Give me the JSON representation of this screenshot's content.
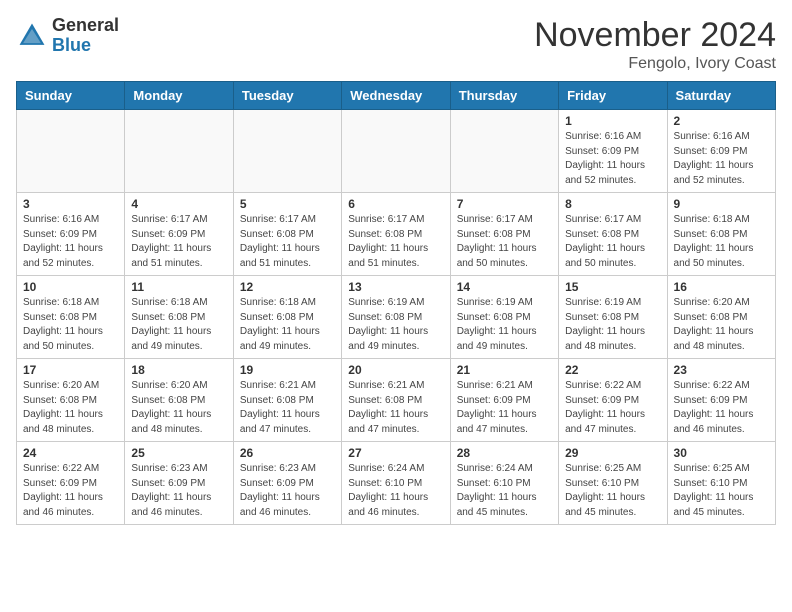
{
  "header": {
    "logo_general": "General",
    "logo_blue": "Blue",
    "month_title": "November 2024",
    "location": "Fengolo, Ivory Coast"
  },
  "days_of_week": [
    "Sunday",
    "Monday",
    "Tuesday",
    "Wednesday",
    "Thursday",
    "Friday",
    "Saturday"
  ],
  "weeks": [
    [
      {
        "day": "",
        "info": ""
      },
      {
        "day": "",
        "info": ""
      },
      {
        "day": "",
        "info": ""
      },
      {
        "day": "",
        "info": ""
      },
      {
        "day": "",
        "info": ""
      },
      {
        "day": "1",
        "info": "Sunrise: 6:16 AM\nSunset: 6:09 PM\nDaylight: 11 hours and 52 minutes."
      },
      {
        "day": "2",
        "info": "Sunrise: 6:16 AM\nSunset: 6:09 PM\nDaylight: 11 hours and 52 minutes."
      }
    ],
    [
      {
        "day": "3",
        "info": "Sunrise: 6:16 AM\nSunset: 6:09 PM\nDaylight: 11 hours and 52 minutes."
      },
      {
        "day": "4",
        "info": "Sunrise: 6:17 AM\nSunset: 6:09 PM\nDaylight: 11 hours and 51 minutes."
      },
      {
        "day": "5",
        "info": "Sunrise: 6:17 AM\nSunset: 6:08 PM\nDaylight: 11 hours and 51 minutes."
      },
      {
        "day": "6",
        "info": "Sunrise: 6:17 AM\nSunset: 6:08 PM\nDaylight: 11 hours and 51 minutes."
      },
      {
        "day": "7",
        "info": "Sunrise: 6:17 AM\nSunset: 6:08 PM\nDaylight: 11 hours and 50 minutes."
      },
      {
        "day": "8",
        "info": "Sunrise: 6:17 AM\nSunset: 6:08 PM\nDaylight: 11 hours and 50 minutes."
      },
      {
        "day": "9",
        "info": "Sunrise: 6:18 AM\nSunset: 6:08 PM\nDaylight: 11 hours and 50 minutes."
      }
    ],
    [
      {
        "day": "10",
        "info": "Sunrise: 6:18 AM\nSunset: 6:08 PM\nDaylight: 11 hours and 50 minutes."
      },
      {
        "day": "11",
        "info": "Sunrise: 6:18 AM\nSunset: 6:08 PM\nDaylight: 11 hours and 49 minutes."
      },
      {
        "day": "12",
        "info": "Sunrise: 6:18 AM\nSunset: 6:08 PM\nDaylight: 11 hours and 49 minutes."
      },
      {
        "day": "13",
        "info": "Sunrise: 6:19 AM\nSunset: 6:08 PM\nDaylight: 11 hours and 49 minutes."
      },
      {
        "day": "14",
        "info": "Sunrise: 6:19 AM\nSunset: 6:08 PM\nDaylight: 11 hours and 49 minutes."
      },
      {
        "day": "15",
        "info": "Sunrise: 6:19 AM\nSunset: 6:08 PM\nDaylight: 11 hours and 48 minutes."
      },
      {
        "day": "16",
        "info": "Sunrise: 6:20 AM\nSunset: 6:08 PM\nDaylight: 11 hours and 48 minutes."
      }
    ],
    [
      {
        "day": "17",
        "info": "Sunrise: 6:20 AM\nSunset: 6:08 PM\nDaylight: 11 hours and 48 minutes."
      },
      {
        "day": "18",
        "info": "Sunrise: 6:20 AM\nSunset: 6:08 PM\nDaylight: 11 hours and 48 minutes."
      },
      {
        "day": "19",
        "info": "Sunrise: 6:21 AM\nSunset: 6:08 PM\nDaylight: 11 hours and 47 minutes."
      },
      {
        "day": "20",
        "info": "Sunrise: 6:21 AM\nSunset: 6:08 PM\nDaylight: 11 hours and 47 minutes."
      },
      {
        "day": "21",
        "info": "Sunrise: 6:21 AM\nSunset: 6:09 PM\nDaylight: 11 hours and 47 minutes."
      },
      {
        "day": "22",
        "info": "Sunrise: 6:22 AM\nSunset: 6:09 PM\nDaylight: 11 hours and 47 minutes."
      },
      {
        "day": "23",
        "info": "Sunrise: 6:22 AM\nSunset: 6:09 PM\nDaylight: 11 hours and 46 minutes."
      }
    ],
    [
      {
        "day": "24",
        "info": "Sunrise: 6:22 AM\nSunset: 6:09 PM\nDaylight: 11 hours and 46 minutes."
      },
      {
        "day": "25",
        "info": "Sunrise: 6:23 AM\nSunset: 6:09 PM\nDaylight: 11 hours and 46 minutes."
      },
      {
        "day": "26",
        "info": "Sunrise: 6:23 AM\nSunset: 6:09 PM\nDaylight: 11 hours and 46 minutes."
      },
      {
        "day": "27",
        "info": "Sunrise: 6:24 AM\nSunset: 6:10 PM\nDaylight: 11 hours and 46 minutes."
      },
      {
        "day": "28",
        "info": "Sunrise: 6:24 AM\nSunset: 6:10 PM\nDaylight: 11 hours and 45 minutes."
      },
      {
        "day": "29",
        "info": "Sunrise: 6:25 AM\nSunset: 6:10 PM\nDaylight: 11 hours and 45 minutes."
      },
      {
        "day": "30",
        "info": "Sunrise: 6:25 AM\nSunset: 6:10 PM\nDaylight: 11 hours and 45 minutes."
      }
    ]
  ]
}
